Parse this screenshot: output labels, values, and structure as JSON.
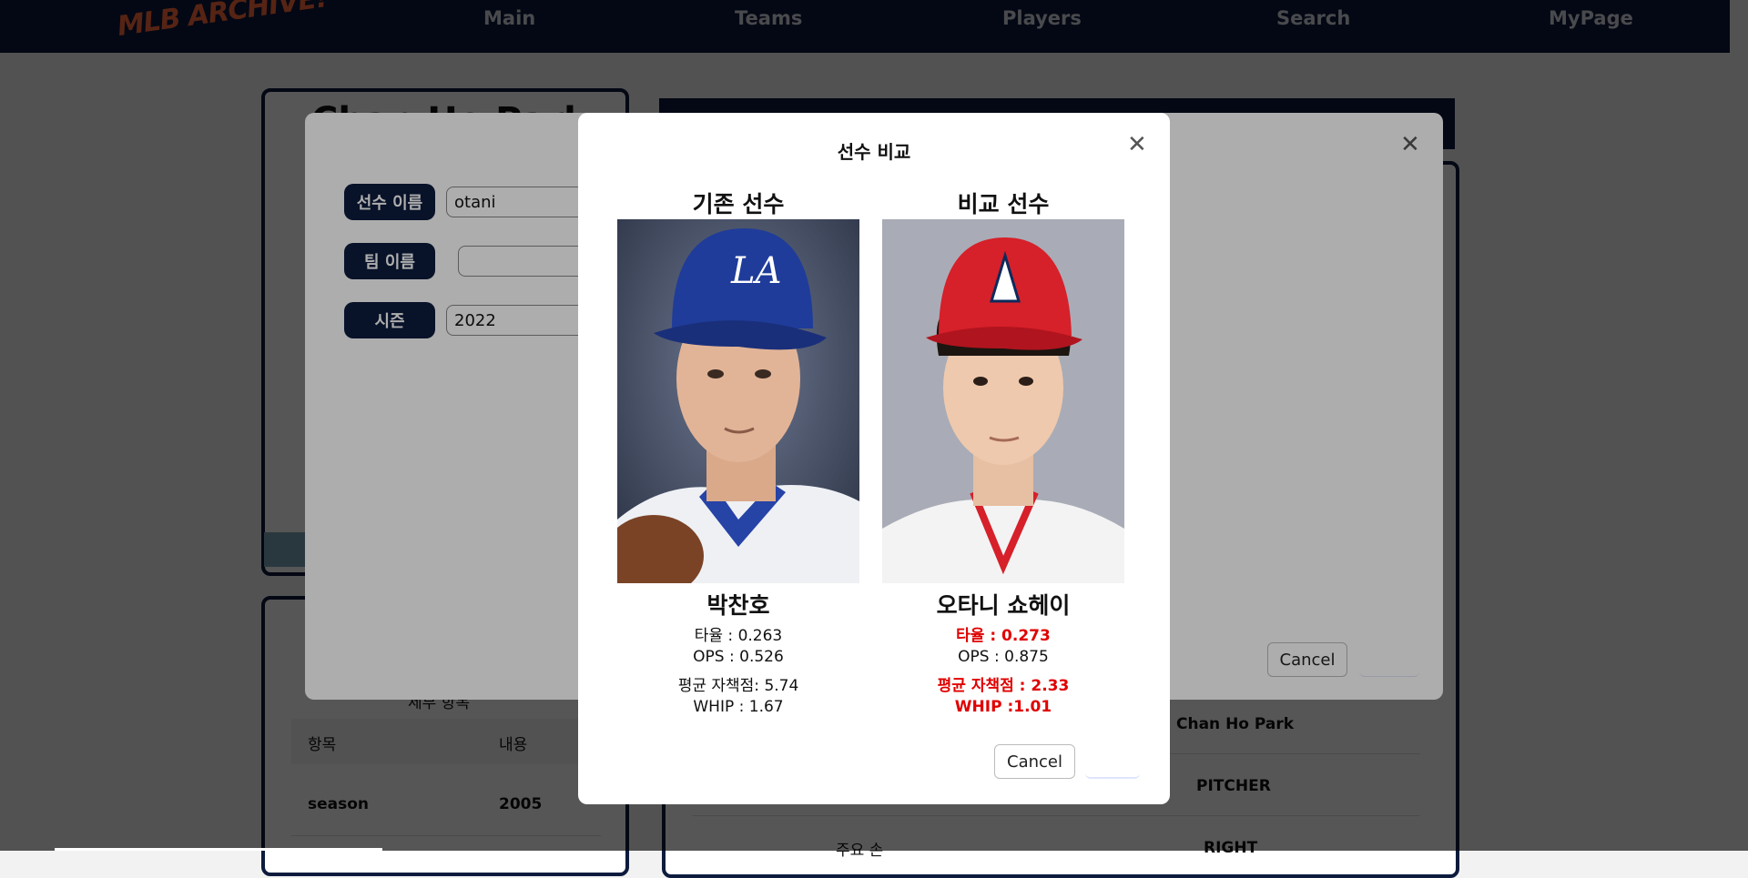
{
  "nav": {
    "logo": "MLB ARCHIVE!",
    "items": [
      "Main",
      "Teams",
      "Players",
      "Search",
      "MyPage"
    ]
  },
  "background": {
    "title": "Chan Ho Park",
    "table_caption": "세부 항목",
    "table_headers": [
      "항목",
      "내용"
    ],
    "rows": [
      {
        "key": "season",
        "value": "2005"
      }
    ],
    "right_values": [
      "Chan Ho Park",
      "PITCHER",
      "RIGHT"
    ],
    "right_partial_label": "주요 손"
  },
  "search_modal": {
    "fields": [
      {
        "label": "선수 이름",
        "value": "otani"
      },
      {
        "label": "팀 이름",
        "value": ""
      },
      {
        "label": "시즌",
        "value": "2022"
      }
    ],
    "cancel_label": "Cancel",
    "close_icon": "close-icon"
  },
  "compare_modal": {
    "title": "선수 비교",
    "close_icon": "close-icon",
    "left": {
      "heading": "기존 선수",
      "name": "박찬호",
      "stats": [
        "타율 : 0.263",
        "OPS : 0.526",
        "평균 자책점: 5.74",
        "WHIP : 1.67"
      ]
    },
    "right": {
      "heading": "비교 선수",
      "name": "오타니 쇼헤이",
      "stats": [
        "타율 : 0.273",
        "OPS : 0.875",
        "평균 자책점 : 2.33",
        "WHIP :1.01"
      ]
    },
    "cancel_label": "Cancel",
    "highlight_color": "#e00000"
  }
}
